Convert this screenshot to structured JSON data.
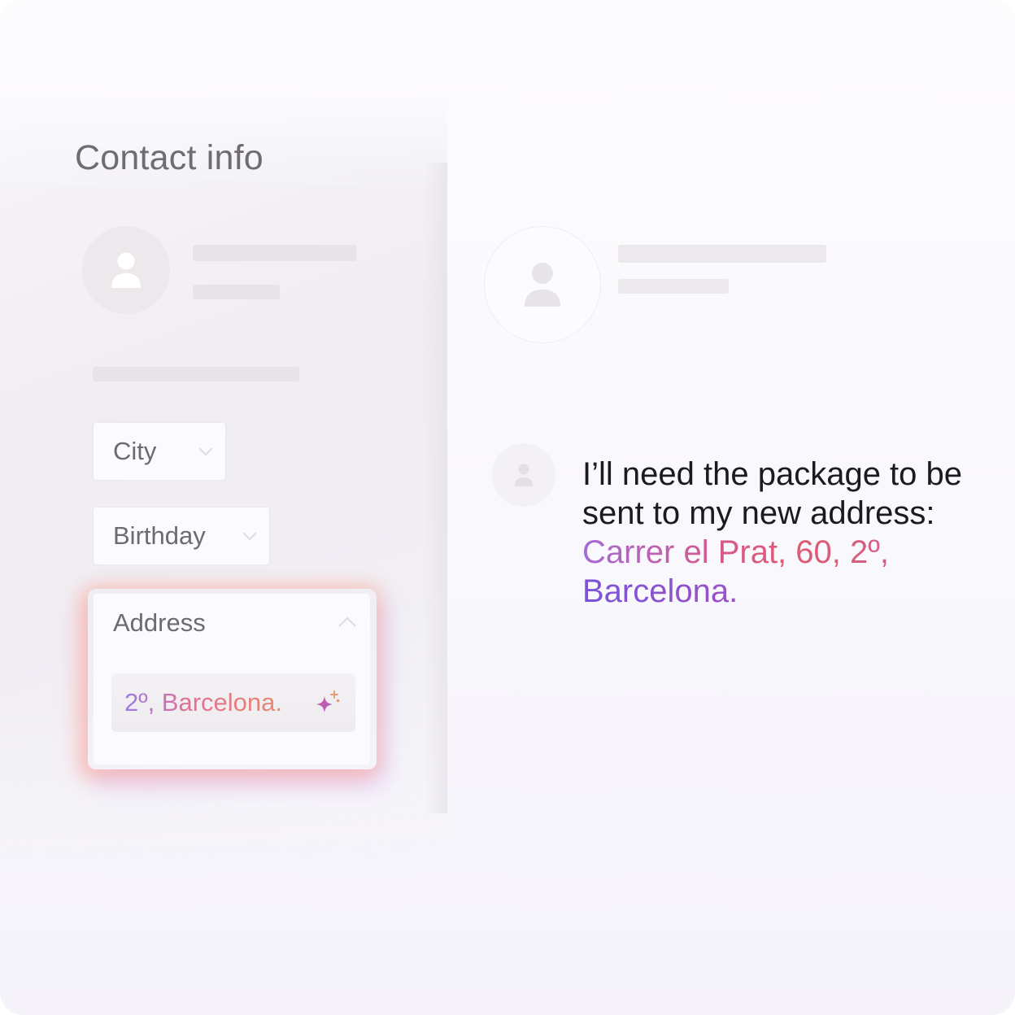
{
  "colors": {
    "accent_purple": "#7b53d8",
    "accent_pink": "#e05a72",
    "accent_orange": "#e88a6a",
    "text_primary": "#1b1a1d",
    "text_muted": "#6d6a70",
    "skeleton": "#e7e3e6"
  },
  "left_panel": {
    "title": "Contact info",
    "avatar_icon": "user-icon",
    "fields": {
      "city": {
        "label": "City",
        "icon": "chevron-down-icon"
      },
      "birthday": {
        "label": "Birthday",
        "icon": "chevron-down-icon"
      },
      "address": {
        "label": "Address",
        "icon": "chevron-up-icon",
        "value": "2º, Barcelona.",
        "action_icon": "sparkle-icon"
      }
    }
  },
  "right_panel": {
    "avatar_icon": "user-icon",
    "message": {
      "avatar_icon": "user-icon",
      "text_plain": "I’ll need the package to be sent to my new address:",
      "address_line1": "Carrer el Prat, 60,  2º,",
      "address_line2": "Barcelona."
    }
  }
}
